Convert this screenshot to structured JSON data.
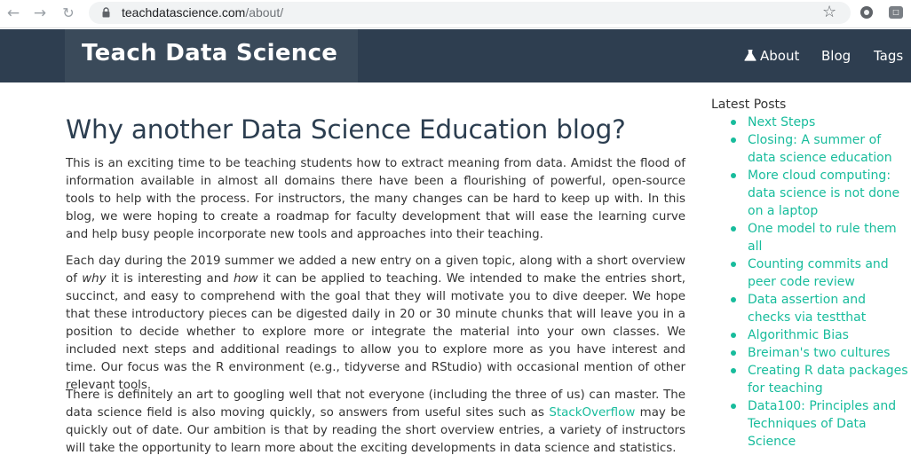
{
  "browser": {
    "url_host": "teachdatascience.com",
    "url_path": "/about/",
    "icons": [
      "back-arrow-icon",
      "forward-arrow-icon",
      "reload-icon",
      "lock-icon",
      "star-icon",
      "extension-icon"
    ]
  },
  "header": {
    "logo": "Teach Data Science",
    "nav": {
      "about": "About",
      "blog": "Blog",
      "tags": "Tags"
    },
    "colors": {
      "background": "#2e3e50",
      "logo_box": "#3a4a5a"
    }
  },
  "main": {
    "title": "Why another Data Science Education blog?",
    "p1": "This is an exciting time to be teaching students how to extract meaning from data. Amidst the flood of information available in almost all domains there have been a flourishing of powerful, open-source tools to help with the process. For instructors, the many changes can be hard to keep up with. In this blog, we were hoping to create a roadmap for faculty development that will ease the learning curve and help busy people incorporate new tools and approaches into their teaching.",
    "p2": {
      "a": "Each day during the 2019 summer we added a new entry on a given topic, along with a short overview of ",
      "why": "why",
      "b": " it is interesting and ",
      "how": "how",
      "c": " it can be applied to teaching. We intended to make the entries short, succinct, and easy to comprehend with the goal that they will motivate you to dive deeper. We hope that these introductory pieces can be digested daily in 20 or 30 minute chunks that will leave you in a position to decide whether to explore more or integrate the material into your own classes. We included next steps and additional readings to allow you to explore more as you have interest and time. Our focus was the R environment (e.g., tidyverse and RStudio) with occasional mention of other relevant tools."
    },
    "p3": {
      "a": "There is definitely an art to googling well that not everyone (including the three of us) can master. The data science field is also moving quickly, so answers from useful sites such as ",
      "link": "StackOverflow",
      "b": " may be quickly out of date. Our ambition is that by reading the short overview entries, a variety of instructors will take the opportunity to learn more about the exciting developments in data science and statistics."
    },
    "colors": {
      "title": "#2c3e50",
      "link": "#18bc9c"
    }
  },
  "sidebar": {
    "title": "Latest Posts",
    "posts": [
      "Next Steps",
      "Closing: A summer of data science education",
      "More cloud computing: data science is not done on a laptop",
      "One model to rule them all",
      "Counting commits and peer code review",
      "Data assertion and checks via testthat",
      "Algorithmic Bias",
      "Breiman's two cultures",
      "Creating R data packages for teaching",
      "Data100: Principles and Techniques of Data Science"
    ]
  }
}
